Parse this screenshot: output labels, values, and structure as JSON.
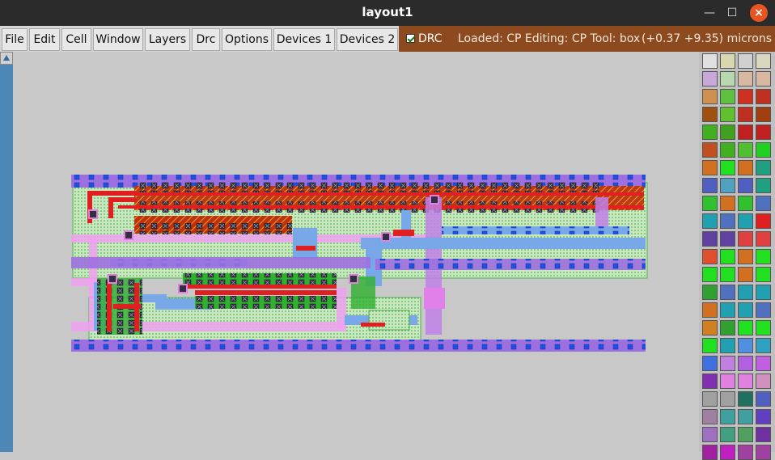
{
  "window": {
    "title": "layout1"
  },
  "menu": {
    "items": [
      "File",
      "Edit",
      "Cell",
      "Window",
      "Layers",
      "Drc",
      "Options",
      "Devices 1",
      "Devices 2"
    ],
    "drc_toggle": {
      "label": "DRC",
      "checked": true
    }
  },
  "status": {
    "text": "Loaded: CP Editing: CP Tool: box",
    "coords": "(+0.37 +9.35) microns"
  },
  "palette": {
    "swatches": [
      [
        "#e0e0e0",
        "#d8d8b0",
        "#d0d0d0",
        "#d8d8c0"
      ],
      [
        "#c8a8d8",
        "#b8d8b0",
        "#d8b8a0",
        "#d8b8a0"
      ],
      [
        "#d09050",
        "#60c040",
        "#d03020",
        "#c03020"
      ],
      [
        "#a05010",
        "#60c030",
        "#c03020",
        "#a04010"
      ],
      [
        "#40b020",
        "#40a020",
        "#c02020",
        "#c02020"
      ],
      [
        "#c05020",
        "#40b020",
        "#50c030",
        "#20d020"
      ],
      [
        "#d07020",
        "#20e020",
        "#d07020",
        "#20a080"
      ],
      [
        "#5060c0",
        "#50a0c0",
        "#5060c0",
        "#20a080"
      ],
      [
        "#30c030",
        "#d07020",
        "#30c030",
        "#5070c0"
      ],
      [
        "#20a0b0",
        "#5070c0",
        "#20a0b0",
        "#e02020"
      ],
      [
        "#6040a0",
        "#6040a0",
        "#e04040",
        "#e04040"
      ],
      [
        "#e05030",
        "#20e020",
        "#d07020",
        "#20e020"
      ],
      [
        "#20e020",
        "#20e020",
        "#d07020",
        "#20e020"
      ],
      [
        "#30a030",
        "#5070c0",
        "#20a0b0",
        "#20a0b0"
      ],
      [
        "#d07020",
        "#20a0b0",
        "#20a0b0",
        "#5070c0"
      ],
      [
        "#d08020",
        "#30a030",
        "#20e020",
        "#20e020"
      ],
      [
        "#20e020",
        "#20a0b0",
        "#5090e0",
        "#30a0c0"
      ],
      [
        "#4070e0",
        "#c080e0",
        "#b060e0",
        "#c060e0"
      ],
      [
        "#8030b0",
        "#e080e0",
        "#e080e0",
        "#d090c0"
      ],
      [
        "#a0a0a0",
        "#a0a0a0",
        "#207060",
        "#5060c0"
      ],
      [
        "#a080a0",
        "#40a0a0",
        "#40a0a0",
        "#6040c0"
      ],
      [
        "#a070c0",
        "#40a080",
        "#50a060",
        "#7030a0"
      ],
      [
        "#a020a0",
        "#c020c0",
        "#a040a0",
        "#a040a0"
      ]
    ]
  },
  "layout": {
    "nwell_color": "#b8e8b0",
    "metal1_color": "#78a8e8",
    "metal2_color": "#9c70e0",
    "poly_color": "#e02020",
    "pselect_color": "#f0a0f0",
    "diff_color": "#c04010",
    "contact_color": "#3050c0"
  }
}
